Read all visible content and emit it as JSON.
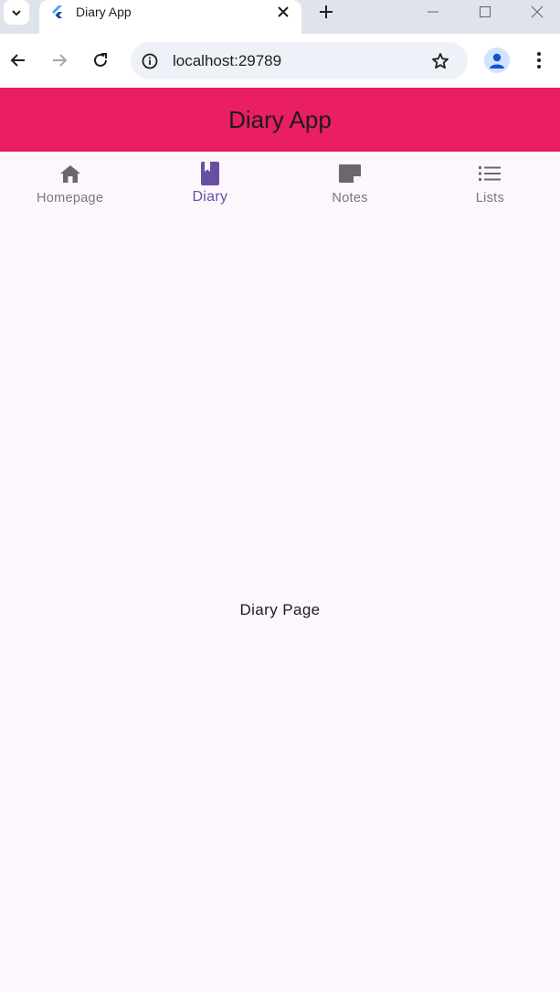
{
  "browser": {
    "tab_title": "Diary App",
    "url": "localhost:29789"
  },
  "app": {
    "title": "Diary App"
  },
  "nav_tabs": [
    {
      "label": "Homepage",
      "icon": "home-icon",
      "active": false
    },
    {
      "label": "Diary",
      "icon": "book-icon",
      "active": true
    },
    {
      "label": "Notes",
      "icon": "note-icon",
      "active": false
    },
    {
      "label": "Lists",
      "icon": "list-icon",
      "active": false
    }
  ],
  "main": {
    "page_text": "Diary Page"
  },
  "colors": {
    "appbar": "#e91e63",
    "active_tab": "#6750a4",
    "inactive_tab": "#79747e",
    "background": "#fdf7fd"
  }
}
